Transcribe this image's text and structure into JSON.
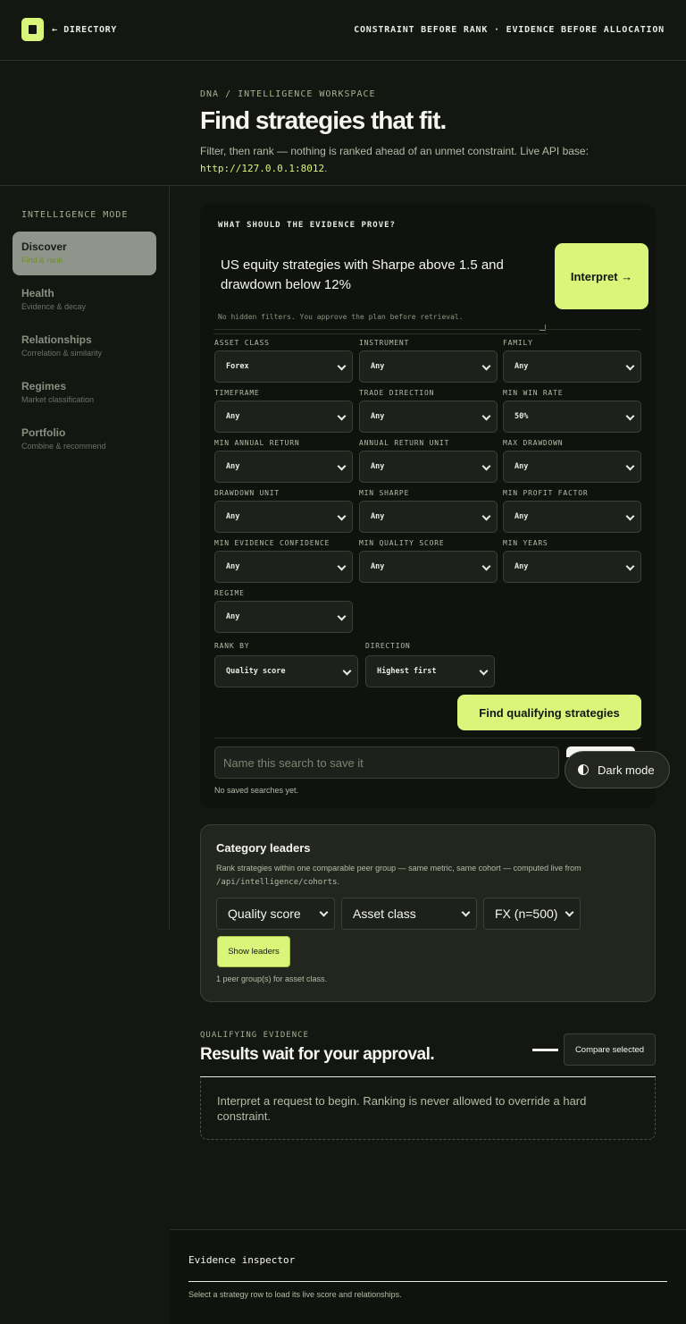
{
  "header": {
    "back_label": "← DIRECTORY",
    "tagline": "CONSTRAINT BEFORE RANK · EVIDENCE BEFORE ALLOCATION"
  },
  "hero": {
    "breadcrumb": "DNA / INTELLIGENCE WORKSPACE",
    "title": "Find strategies that fit.",
    "subtitle": "Filter, then rank — nothing is ranked ahead of an unmet constraint. Live API base: ",
    "api_base": "http://127.0.0.1:8012",
    "subtitle_end": "."
  },
  "sidebar": {
    "title": "INTELLIGENCE MODE",
    "items": [
      {
        "label": "Discover",
        "desc": "Find & rank",
        "active": true
      },
      {
        "label": "Health",
        "desc": "Evidence & decay",
        "active": false
      },
      {
        "label": "Relationships",
        "desc": "Correlation & similarity",
        "active": false
      },
      {
        "label": "Regimes",
        "desc": "Market classification",
        "active": false
      },
      {
        "label": "Portfolio",
        "desc": "Combine & recommend",
        "active": false
      }
    ]
  },
  "query_panel": {
    "prompt": "WHAT SHOULD THE EVIDENCE PROVE?",
    "query_text": "US equity strategies with Sharpe above 1.5 and drawdown below 12%",
    "interpret_label": "Interpret →",
    "note": "No hidden filters. You approve the plan before retrieval."
  },
  "filters": [
    {
      "label": "ASSET CLASS",
      "value": "Forex"
    },
    {
      "label": "INSTRUMENT",
      "value": "Any"
    },
    {
      "label": "FAMILY",
      "value": "Any"
    },
    {
      "label": "TIMEFRAME",
      "value": "Any"
    },
    {
      "label": "TRADE DIRECTION",
      "value": "Any"
    },
    {
      "label": "MIN WIN RATE",
      "value": "50%"
    },
    {
      "label": "MIN ANNUAL RETURN",
      "value": "Any"
    },
    {
      "label": "ANNUAL RETURN UNIT",
      "value": "Any"
    },
    {
      "label": "MAX DRAWDOWN",
      "value": "Any"
    },
    {
      "label": "DRAWDOWN UNIT",
      "value": "Any"
    },
    {
      "label": "MIN SHARPE",
      "value": "Any"
    },
    {
      "label": "MIN PROFIT FACTOR",
      "value": "Any"
    },
    {
      "label": "MIN EVIDENCE CONFIDENCE",
      "value": "Any"
    },
    {
      "label": "MIN QUALITY SCORE",
      "value": "Any"
    },
    {
      "label": "MIN YEARS",
      "value": "Any"
    },
    {
      "label": "REGIME",
      "value": "Any"
    }
  ],
  "ranking": {
    "rank_by_label": "RANK BY",
    "rank_by_value": "Quality score",
    "direction_label": "DIRECTION",
    "direction_value": "Highest first"
  },
  "find_label": "Find qualifying strategies",
  "save": {
    "placeholder": "Name this search to save it",
    "empty": "No saved searches yet."
  },
  "dark_mode_label": "Dark mode",
  "leaders": {
    "title": "Category leaders",
    "desc": "Rank strategies within one comparable peer group — same metric, same cohort — computed live from ",
    "api": "/api/intelligence/cohorts",
    "desc_end": ".",
    "metric": "Quality score",
    "group": "Asset class",
    "cohort": "FX (n=500)",
    "show_label": "Show leaders",
    "status": "1 peer group(s) for asset class."
  },
  "results": {
    "eyebrow": "QUALIFYING EVIDENCE",
    "title": "Results wait for your approval.",
    "compare_label": "Compare selected",
    "empty_text": "Interpret a request to begin. Ranking is never allowed to override a hard constraint."
  },
  "inspector": {
    "title": "Evidence inspector",
    "note": "Select a strategy row to load its live score and relationships."
  },
  "colors": {
    "accent": "#d9f57a",
    "background": "#141612",
    "panel": "#10120e"
  }
}
